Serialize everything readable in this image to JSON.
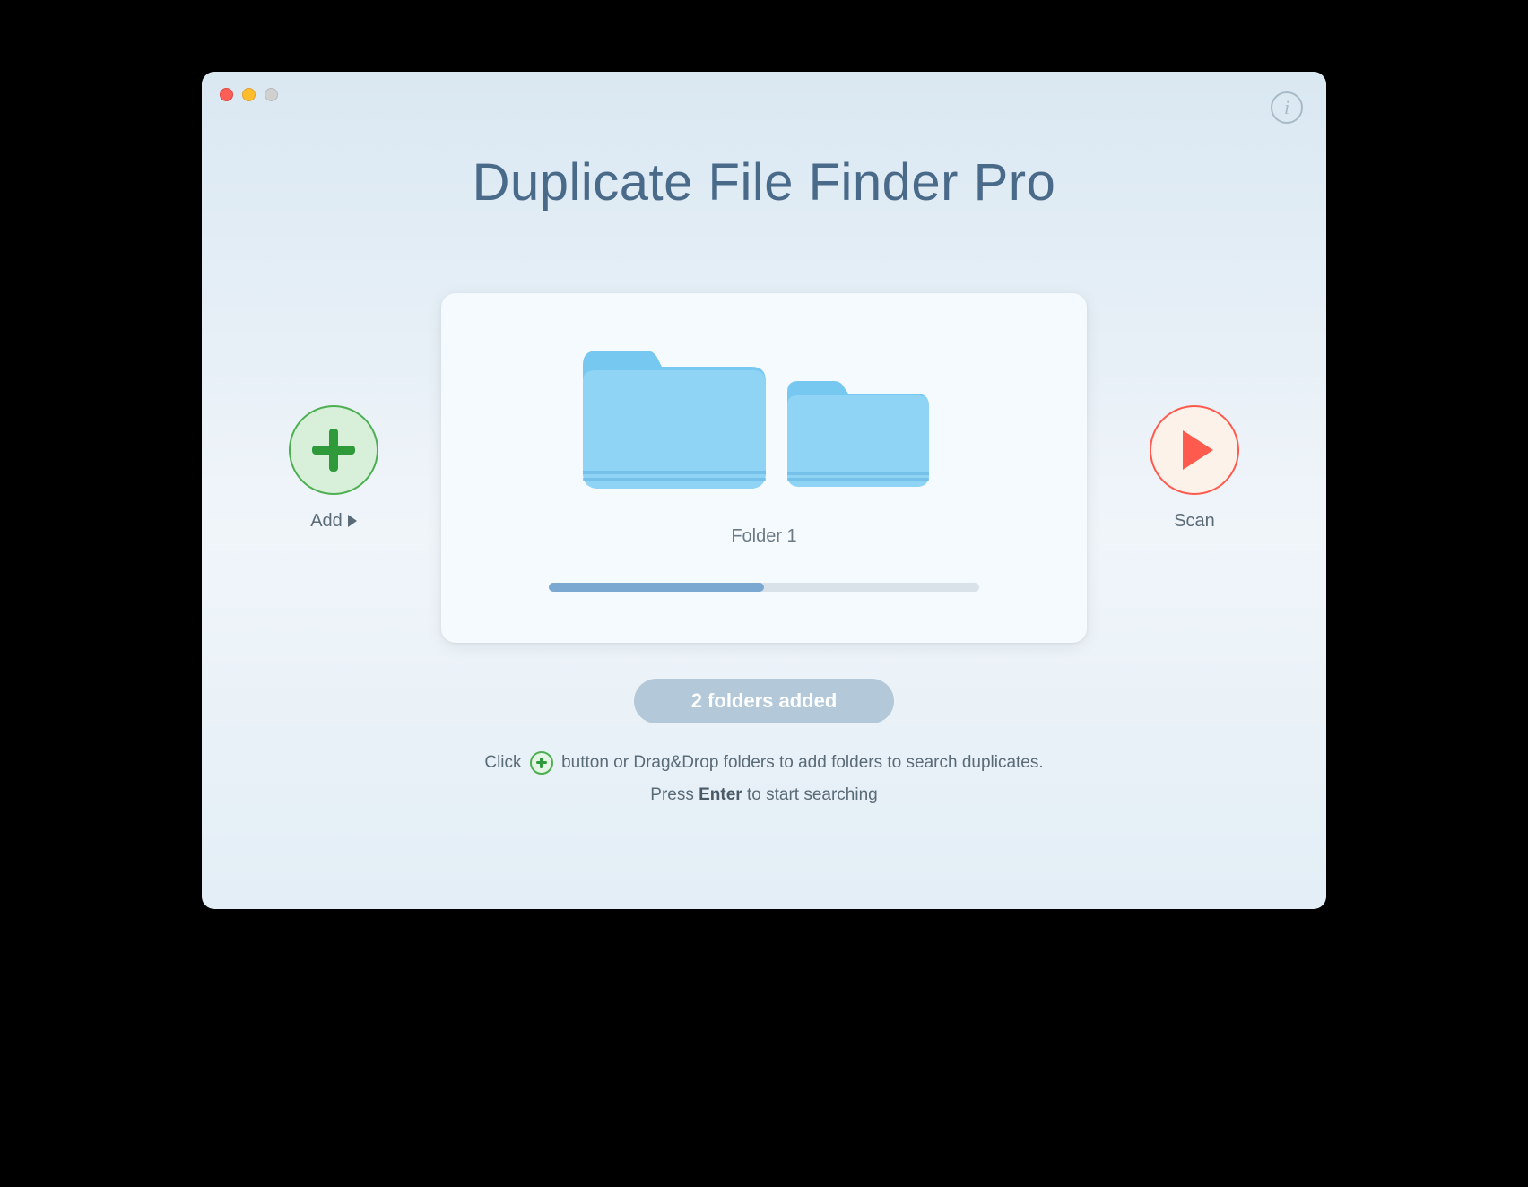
{
  "app": {
    "title": "Duplicate File Finder Pro"
  },
  "buttons": {
    "add_label": "Add",
    "scan_label": "Scan"
  },
  "card": {
    "folder_primary_name": "Folder 1",
    "slider_percent": 50
  },
  "status": {
    "badge": "2 folders added"
  },
  "hints": {
    "line1_pre": "Click",
    "line1_post": "button or Drag&Drop folders to add folders to search duplicates.",
    "line2_pre": "Press",
    "line2_key": "Enter",
    "line2_post": "to start searching"
  },
  "icons": {
    "info": "i",
    "plus": "plus-icon",
    "play": "play-icon",
    "folder": "folder-icon"
  },
  "colors": {
    "accent_green": "#2e9a3a",
    "accent_red": "#ff5a4e",
    "title_blue": "#4a6a8a",
    "folder_blue": "#6cc3ef"
  }
}
